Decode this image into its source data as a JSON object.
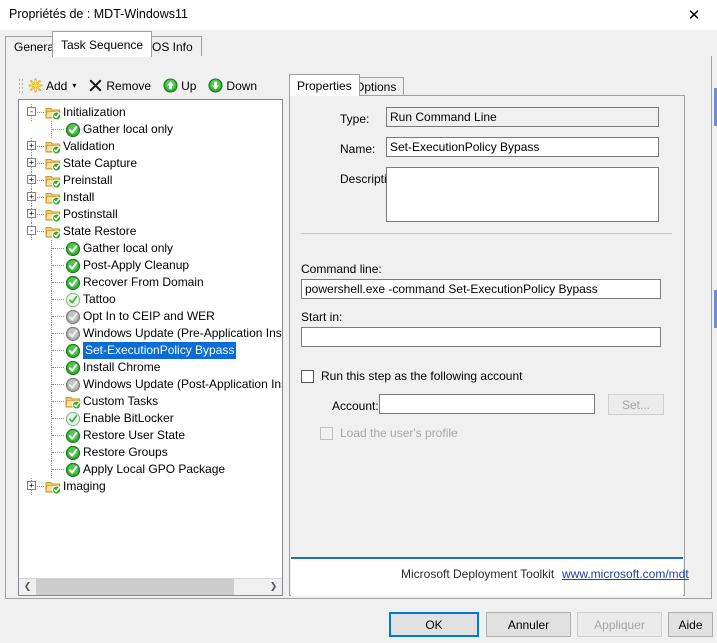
{
  "window": {
    "title": "Propriétés de : MDT-Windows11",
    "close_label": "✕"
  },
  "tabs": [
    {
      "label": "General",
      "active": false
    },
    {
      "label": "Task Sequence",
      "active": true
    },
    {
      "label": "OS Info",
      "active": false
    }
  ],
  "toolbar": {
    "add_label": "Add",
    "add_caret": "▾",
    "remove_label": "Remove",
    "remove_glyph": "✕",
    "up_label": "Up",
    "down_label": "Down"
  },
  "tree": {
    "items": [
      {
        "label": "Initialization",
        "depth": 0,
        "toggle": "-",
        "icon": "folder-check",
        "selected": false
      },
      {
        "label": "Gather local only",
        "depth": 1,
        "toggle": "",
        "icon": "check-green",
        "selected": false
      },
      {
        "label": "Validation",
        "depth": 0,
        "toggle": "+",
        "icon": "folder-check",
        "selected": false
      },
      {
        "label": "State Capture",
        "depth": 0,
        "toggle": "+",
        "icon": "folder-check",
        "selected": false
      },
      {
        "label": "Preinstall",
        "depth": 0,
        "toggle": "+",
        "icon": "folder-check",
        "selected": false
      },
      {
        "label": "Install",
        "depth": 0,
        "toggle": "+",
        "icon": "folder-check",
        "selected": false
      },
      {
        "label": "Postinstall",
        "depth": 0,
        "toggle": "+",
        "icon": "folder-check",
        "selected": false
      },
      {
        "label": "State Restore",
        "depth": 0,
        "toggle": "-",
        "icon": "folder-check",
        "selected": false
      },
      {
        "label": "Gather local only",
        "depth": 1,
        "toggle": "",
        "icon": "check-green",
        "selected": false
      },
      {
        "label": "Post-Apply Cleanup",
        "depth": 1,
        "toggle": "",
        "icon": "check-green",
        "selected": false
      },
      {
        "label": "Recover From Domain",
        "depth": 1,
        "toggle": "",
        "icon": "check-green",
        "selected": false
      },
      {
        "label": "Tattoo",
        "depth": 1,
        "toggle": "",
        "icon": "check-pale",
        "selected": false
      },
      {
        "label": "Opt In to CEIP and WER",
        "depth": 1,
        "toggle": "",
        "icon": "check-grey",
        "selected": false
      },
      {
        "label": "Windows Update (Pre-Application Installa",
        "depth": 1,
        "toggle": "",
        "icon": "check-grey",
        "selected": false
      },
      {
        "label": "Set-ExecutionPolicy Bypass",
        "depth": 1,
        "toggle": "",
        "icon": "check-green",
        "selected": true
      },
      {
        "label": "Install Chrome",
        "depth": 1,
        "toggle": "",
        "icon": "check-green",
        "selected": false
      },
      {
        "label": "Windows Update (Post-Application Install",
        "depth": 1,
        "toggle": "",
        "icon": "check-grey",
        "selected": false
      },
      {
        "label": "Custom Tasks",
        "depth": 1,
        "toggle": "",
        "icon": "folder-check",
        "selected": false
      },
      {
        "label": "Enable BitLocker",
        "depth": 1,
        "toggle": "",
        "icon": "check-pale",
        "selected": false
      },
      {
        "label": "Restore User State",
        "depth": 1,
        "toggle": "",
        "icon": "check-green",
        "selected": false
      },
      {
        "label": "Restore Groups",
        "depth": 1,
        "toggle": "",
        "icon": "check-green",
        "selected": false
      },
      {
        "label": "Apply Local GPO Package",
        "depth": 1,
        "toggle": "",
        "icon": "check-green",
        "selected": false
      },
      {
        "label": "Imaging",
        "depth": 0,
        "toggle": "+",
        "icon": "folder-check",
        "selected": false
      }
    ],
    "hscroll": {
      "left_arrow": "❮",
      "right_arrow": "❯"
    }
  },
  "right_tabs": [
    {
      "label": "Properties",
      "active": true
    },
    {
      "label": "Options",
      "active": false
    }
  ],
  "properties": {
    "type_label": "Type:",
    "type_value": "Run Command Line",
    "name_label": "Name:",
    "name_value": "Set-ExecutionPolicy Bypass",
    "description_label": "Description:",
    "description_value": "",
    "command_line_label": "Command line:",
    "command_line_value": "powershell.exe -command Set-ExecutionPolicy Bypass",
    "start_in_label": "Start in:",
    "start_in_value": "",
    "start_in_placeholder": "",
    "run_as_label": "Run this step as the following account",
    "run_as_checked": false,
    "account_label": "Account:",
    "account_value": "",
    "set_button_label": "Set...",
    "load_profile_label": "Load the user's profile",
    "load_profile_checked": false
  },
  "branding": {
    "text": "Microsoft Deployment Toolkit",
    "link": "www.microsoft.com/mdt",
    "accent_color": "#1d6fb7"
  },
  "footer_buttons": [
    {
      "label": "OK",
      "state": "default"
    },
    {
      "label": "Annuler",
      "state": "normal"
    },
    {
      "label": "Appliquer",
      "state": "disabled"
    },
    {
      "label": "Aide",
      "state": "normal"
    }
  ]
}
